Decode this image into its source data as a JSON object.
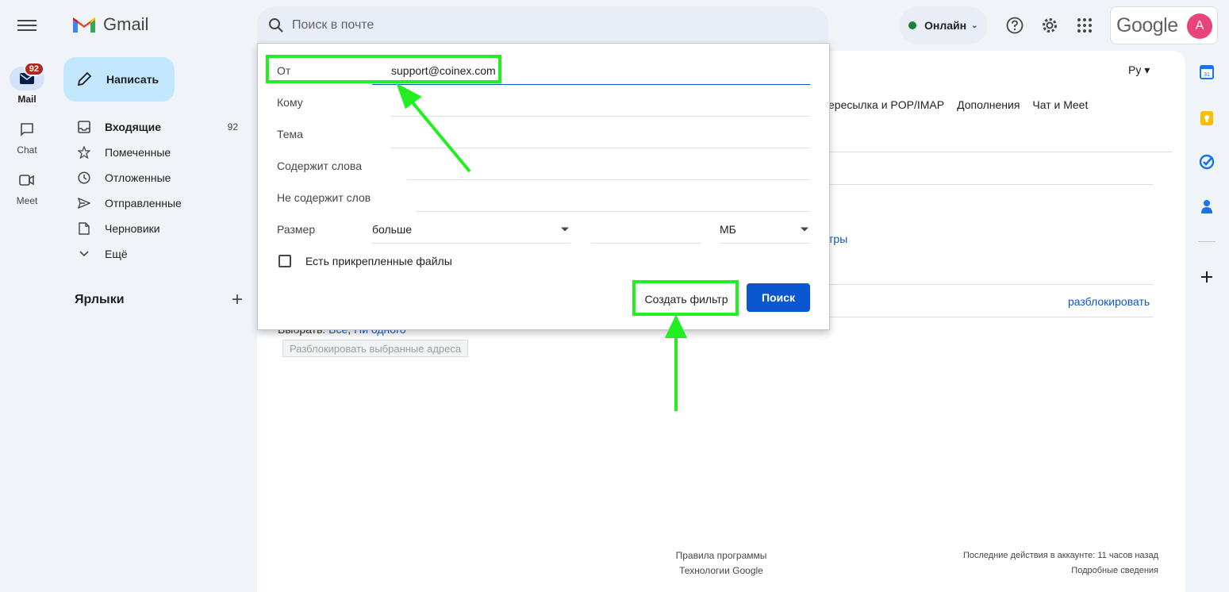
{
  "app": {
    "name": "Gmail"
  },
  "rail": {
    "mail_label": "Mail",
    "mail_badge": "92",
    "chat_label": "Chat",
    "meet_label": "Meet"
  },
  "compose": {
    "label": "Написать"
  },
  "nav": {
    "items": [
      {
        "label": "Входящие",
        "count": "92"
      },
      {
        "label": "Помеченные"
      },
      {
        "label": "Отложенные"
      },
      {
        "label": "Отправленные"
      },
      {
        "label": "Черновики"
      },
      {
        "label": "Ещё"
      }
    ],
    "labels_heading": "Ярлыки"
  },
  "topbar": {
    "search_placeholder": "Поиск в почте",
    "status": "Онлайн",
    "google_wordmark": "Google",
    "avatar_letter": "A"
  },
  "main": {
    "lang": "Ру",
    "tabs": [
      "ересылка и POP/IMAP",
      "Дополнения",
      "Чат и Meet"
    ],
    "link_fragment": "тры",
    "unblock_link": "разблокировать",
    "select_prefix": "Выбрать:",
    "select_all": "Все",
    "select_none": "Ни одного",
    "unblock_selected_btn": "Разблокировать выбранные адреса",
    "footer_left": [
      "Правила программы",
      "Технологии Google"
    ],
    "footer_right": [
      "Последние действия в аккаунте: 11 часов назад",
      "Подробные сведения"
    ]
  },
  "filter_panel": {
    "from_label": "От",
    "from_value": "support@coinex.com",
    "to_label": "Кому",
    "subject_label": "Тема",
    "has_words_label": "Содержит слова",
    "not_has_label": "Не содержит слов",
    "size_label": "Размер",
    "size_op": "больше",
    "size_unit": "МБ",
    "attach_label": "Есть прикрепленные файлы",
    "create_filter": "Создать фильтр",
    "search_btn": "Поиск"
  },
  "colors": {
    "annotation": "#22ee22",
    "primary": "#0b57d0",
    "compose_bg": "#c2e7ff"
  }
}
